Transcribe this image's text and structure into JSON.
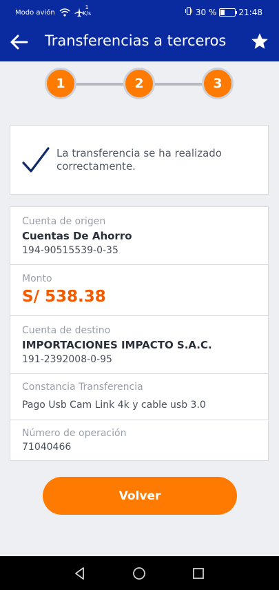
{
  "status_bar": {
    "airplane_text": "Modo avión",
    "speed_value": "1",
    "speed_unit": "K/s",
    "battery_percent": "30 %",
    "battery_level": 0.3,
    "time": "21:48",
    "icons": [
      "wifi-icon",
      "airplane-icon",
      "vibrate-icon",
      "battery-icon"
    ]
  },
  "app_bar": {
    "title": "Transferencias a terceros",
    "back_icon": "arrow-left-icon",
    "favorite_icon": "star-icon"
  },
  "stepper": {
    "steps": [
      "1",
      "2",
      "3"
    ],
    "accent_color": "#ff7a00"
  },
  "success": {
    "icon": "check-icon",
    "message": "La transferencia se ha realizado correctamente."
  },
  "details": {
    "origin": {
      "label": "Cuenta de origen",
      "name": "Cuentas De Ahorro",
      "number": "194-90515539-0-35"
    },
    "amount": {
      "label": "Monto",
      "value": "S/ 538.38"
    },
    "destination": {
      "label": "Cuenta de destino",
      "name": "IMPORTACIONES IMPACTO S.A.C.",
      "number": "191-2392008-0-95"
    },
    "receipt": {
      "label": "Constancia Transferencia",
      "value": "Pago Usb Cam Link 4k y cable usb 3.0"
    },
    "operation": {
      "label": "Número de operación",
      "value": "71040466"
    }
  },
  "actions": {
    "volver_label": "Volver"
  },
  "colors": {
    "primary": "#0a2a9f",
    "accent": "#ff7a00",
    "amount": "#f45b00",
    "background": "#eeeff3"
  }
}
